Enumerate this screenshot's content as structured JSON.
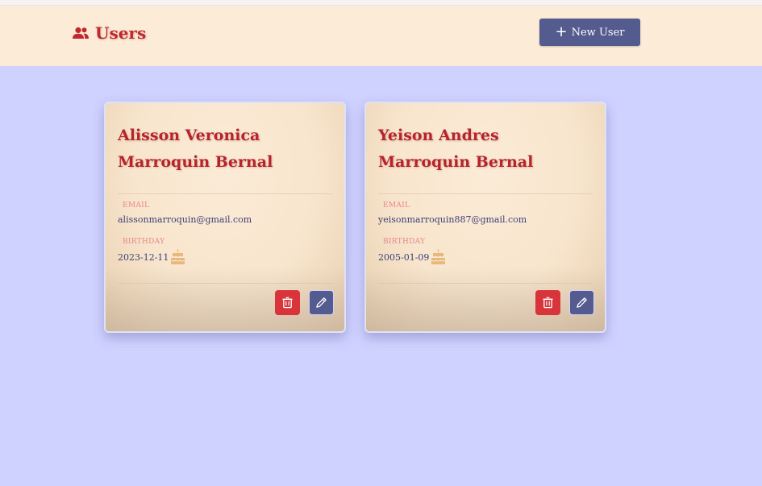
{
  "header": {
    "brand_icon": "users-icon",
    "title": "Users",
    "new_user_label": "New User",
    "new_user_icon": "plus-icon"
  },
  "users": [
    {
      "name": "Alisson Veronica Marroquin Bernal",
      "email_label": "EMAIL",
      "email": "alissonmarroquin@gmail.com",
      "birthday_label": "BIRTHDAY",
      "birthday": "2023-12-11",
      "birthday_icon": "cake-icon",
      "actions": [
        "trash-icon",
        "pencil-icon"
      ]
    },
    {
      "name": "Yeison Andres Marroquin Bernal",
      "email_label": "EMAIL",
      "email": "yeisonmarroquin887@gmail.com",
      "birthday_label": "BIRTHDAY",
      "birthday": "2005-01-09",
      "birthday_icon": "cake-icon",
      "actions": [
        "trash-icon",
        "pencil-icon"
      ]
    }
  ],
  "colors": {
    "page_background": "#cfd1ff",
    "header_background": "#fbebd7",
    "accent_red": "#c0282d",
    "button_blue": "#545b8f",
    "delete_red": "#d8353b",
    "label_pink": "#e8868c",
    "value_text": "#3a3f7a",
    "cake_orange": "#e8b77a"
  }
}
